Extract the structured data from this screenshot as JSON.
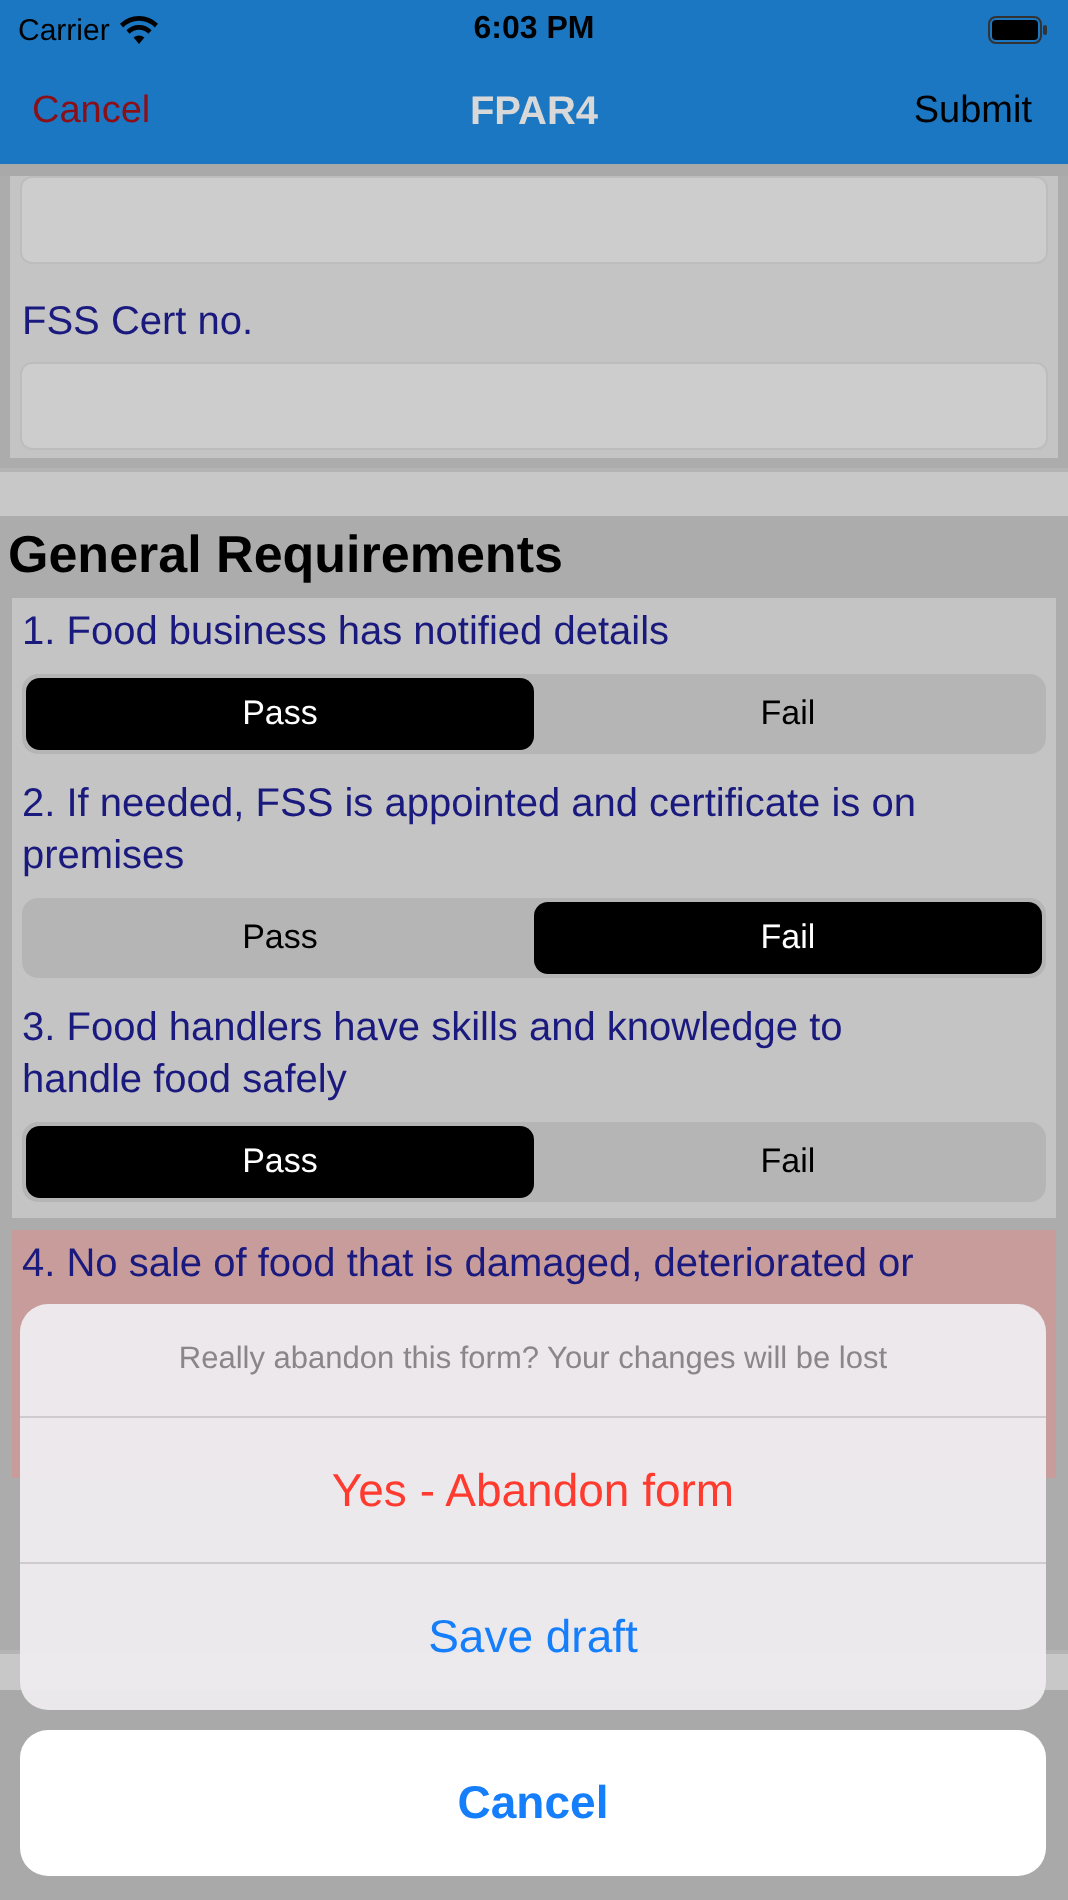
{
  "status_bar": {
    "carrier": "Carrier",
    "time": "6:03 PM"
  },
  "nav": {
    "left": "Cancel",
    "title": "FPAR4",
    "right": "Submit"
  },
  "fields": [
    {
      "label": "FSS Cert no."
    }
  ],
  "sections": [
    {
      "title": "General Requirements",
      "items": [
        {
          "text": "1. Food business has notified details",
          "flagged": false,
          "options": [
            {
              "label": "Pass",
              "selected": true
            },
            {
              "label": "Fail",
              "selected": false
            }
          ]
        },
        {
          "text": "2. If needed, FSS is appointed and certificate is on premises",
          "flagged": false,
          "options": [
            {
              "label": "Pass",
              "selected": false
            },
            {
              "label": "Fail",
              "selected": true
            }
          ]
        },
        {
          "text": "3. Food handlers have skills and knowledge to handle food safely",
          "flagged": false,
          "options": [
            {
              "label": "Pass",
              "selected": true
            },
            {
              "label": "Fail",
              "selected": false
            }
          ]
        },
        {
          "text": "4. No sale of food that is damaged, deteriorated or",
          "flagged": true
        }
      ]
    }
  ],
  "action_sheet": {
    "message": "Really abandon this form? Your changes will be lost",
    "actions": [
      {
        "label": "Yes - Abandon form",
        "kind": "destructive"
      },
      {
        "label": "Save draft",
        "kind": "default"
      }
    ],
    "cancel": "Cancel"
  }
}
